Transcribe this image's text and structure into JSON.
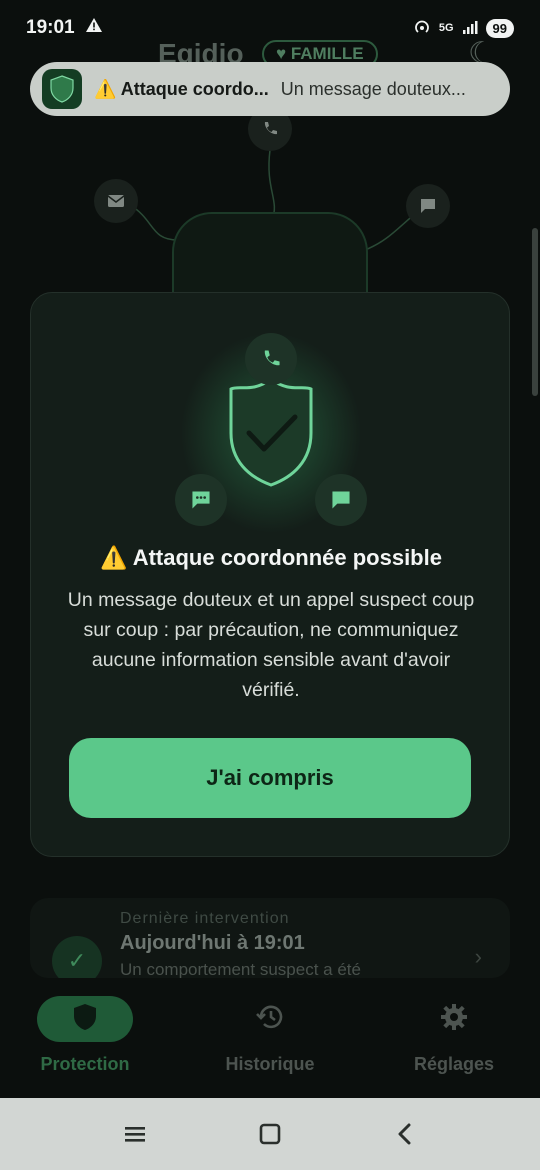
{
  "statusbar": {
    "time": "19:01",
    "battery": "99",
    "network": "5G"
  },
  "app": {
    "title": "Egidio",
    "plan_badge": "FAMILLE"
  },
  "notification": {
    "title": "⚠️ Attaque coordo...",
    "body": "Un message douteux..."
  },
  "dialog": {
    "title": "⚠️ Attaque coordonnée possible",
    "body": "Un message douteux et un appel suspect coup sur coup : par précaution, ne communiquez aucune information sensible avant d'avoir vérifié.",
    "confirm_label": "J'ai compris"
  },
  "last_intervention": {
    "label": "Dernière intervention",
    "time": "Aujourd'hui à 19:01",
    "description": "Un comportement suspect a été"
  },
  "bottom_nav": {
    "items": [
      {
        "label": "Protection",
        "icon": "shield-icon",
        "active": true
      },
      {
        "label": "Historique",
        "icon": "history-icon",
        "active": false
      },
      {
        "label": "Réglages",
        "icon": "gear-icon",
        "active": false
      }
    ]
  },
  "colors": {
    "accent": "#5bc88a",
    "background": "#0b0f0d",
    "dialog": "#141e19"
  }
}
